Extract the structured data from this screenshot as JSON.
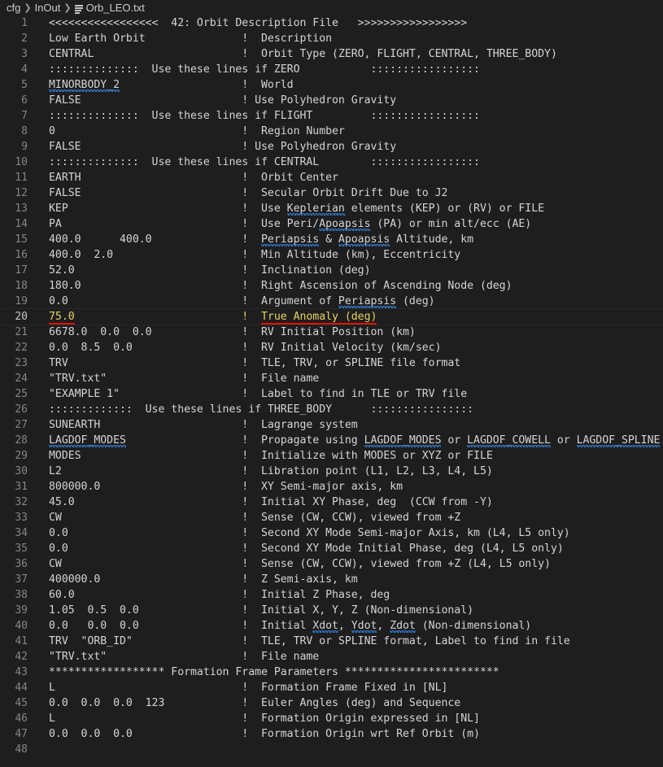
{
  "breadcrumb": {
    "items": [
      "cfg",
      "InOut",
      "Orb_LEO.txt"
    ],
    "separator_icon": "chevron-right-icon",
    "file_icon": "lines-file-icon"
  },
  "editor": {
    "current_line": 20,
    "colors": {
      "background": "#1e1e1e",
      "text": "#d4d4d4",
      "line_number": "#858585",
      "current_line_text": "#e6d160",
      "annotation_red": "#e51400",
      "spell_squiggle": "#3794ff"
    },
    "lines": [
      {
        "n": "1",
        "text": "<<<<<<<<<<<<<<<<<  42: Orbit Description File   >>>>>>>>>>>>>>>>>"
      },
      {
        "n": "2",
        "text": "Low Earth Orbit               !  Description"
      },
      {
        "n": "3",
        "text": "CENTRAL                       !  Orbit Type (ZERO, FLIGHT, CENTRAL, THREE_BODY)"
      },
      {
        "n": "4",
        "text": "::::::::::::::  Use these lines if ZERO           :::::::::::::::::"
      },
      {
        "n": "5",
        "text": "MINORBODY_2                   !  World"
      },
      {
        "n": "6",
        "text": "FALSE                         ! Use Polyhedron Gravity"
      },
      {
        "n": "7",
        "text": "::::::::::::::  Use these lines if FLIGHT         :::::::::::::::::"
      },
      {
        "n": "8",
        "text": "0                             !  Region Number"
      },
      {
        "n": "9",
        "text": "FALSE                         ! Use Polyhedron Gravity"
      },
      {
        "n": "10",
        "text": "::::::::::::::  Use these lines if CENTRAL        :::::::::::::::::"
      },
      {
        "n": "11",
        "text": "EARTH                         !  Orbit Center"
      },
      {
        "n": "12",
        "text": "FALSE                         !  Secular Orbit Drift Due to J2"
      },
      {
        "n": "13",
        "text": "KEP                           !  Use Keplerian elements (KEP) or (RV) or FILE"
      },
      {
        "n": "14",
        "text": "PA                            !  Use Peri/Apoapsis (PA) or min alt/ecc (AE)"
      },
      {
        "n": "15",
        "text": "400.0      400.0              !  Periapsis & Apoapsis Altitude, km"
      },
      {
        "n": "16",
        "text": "400.0  2.0                    !  Min Altitude (km), Eccentricity"
      },
      {
        "n": "17",
        "text": "52.0                          !  Inclination (deg)"
      },
      {
        "n": "18",
        "text": "180.0                         !  Right Ascension of Ascending Node (deg)"
      },
      {
        "n": "19",
        "text": "0.0                           !  Argument of Periapsis (deg)"
      },
      {
        "n": "20",
        "text": "75.0                          !  True Anomaly (deg)"
      },
      {
        "n": "21",
        "text": "6678.0  0.0  0.0              !  RV Initial Position (km)"
      },
      {
        "n": "22",
        "text": "0.0  8.5  0.0                 !  RV Initial Velocity (km/sec)"
      },
      {
        "n": "23",
        "text": "TRV                           !  TLE, TRV, or SPLINE file format"
      },
      {
        "n": "24",
        "text": "\"TRV.txt\"                     !  File name"
      },
      {
        "n": "25",
        "text": "\"EXAMPLE 1\"                   !  Label to find in TLE or TRV file"
      },
      {
        "n": "26",
        "text": ":::::::::::::  Use these lines if THREE_BODY      ::::::::::::::::"
      },
      {
        "n": "27",
        "text": "SUNEARTH                      !  Lagrange system"
      },
      {
        "n": "28",
        "text": "LAGDOF_MODES                  !  Propagate using LAGDOF_MODES or LAGDOF_COWELL or LAGDOF_SPLINE"
      },
      {
        "n": "29",
        "text": "MODES                         !  Initialize with MODES or XYZ or FILE"
      },
      {
        "n": "30",
        "text": "L2                            !  Libration point (L1, L2, L3, L4, L5)"
      },
      {
        "n": "31",
        "text": "800000.0                      !  XY Semi-major axis, km"
      },
      {
        "n": "32",
        "text": "45.0                          !  Initial XY Phase, deg  (CCW from -Y)"
      },
      {
        "n": "33",
        "text": "CW                            !  Sense (CW, CCW), viewed from +Z"
      },
      {
        "n": "34",
        "text": "0.0                           !  Second XY Mode Semi-major Axis, km (L4, L5 only)"
      },
      {
        "n": "35",
        "text": "0.0                           !  Second XY Mode Initial Phase, deg (L4, L5 only)"
      },
      {
        "n": "36",
        "text": "CW                            !  Sense (CW, CCW), viewed from +Z (L4, L5 only)"
      },
      {
        "n": "37",
        "text": "400000.0                      !  Z Semi-axis, km"
      },
      {
        "n": "38",
        "text": "60.0                          !  Initial Z Phase, deg"
      },
      {
        "n": "39",
        "text": "1.05  0.5  0.0                !  Initial X, Y, Z (Non-dimensional)"
      },
      {
        "n": "40",
        "text": "0.0   0.0  0.0                !  Initial Xdot, Ydot, Zdot (Non-dimensional)"
      },
      {
        "n": "41",
        "text": "TRV  \"ORB_ID\"                 !  TLE, TRV or SPLINE format, Label to find in file"
      },
      {
        "n": "42",
        "text": "\"TRV.txt\"                     !  File name"
      },
      {
        "n": "43",
        "text": "****************** Formation Frame Parameters ************************"
      },
      {
        "n": "44",
        "text": "L                             !  Formation Frame Fixed in [NL]"
      },
      {
        "n": "45",
        "text": "0.0  0.0  0.0  123            !  Euler Angles (deg) and Sequence"
      },
      {
        "n": "46",
        "text": "L                             !  Formation Origin expressed in [NL]"
      },
      {
        "n": "47",
        "text": "0.0  0.0  0.0                 !  Formation Origin wrt Ref Orbit (m)"
      },
      {
        "n": "48",
        "text": ""
      }
    ]
  }
}
